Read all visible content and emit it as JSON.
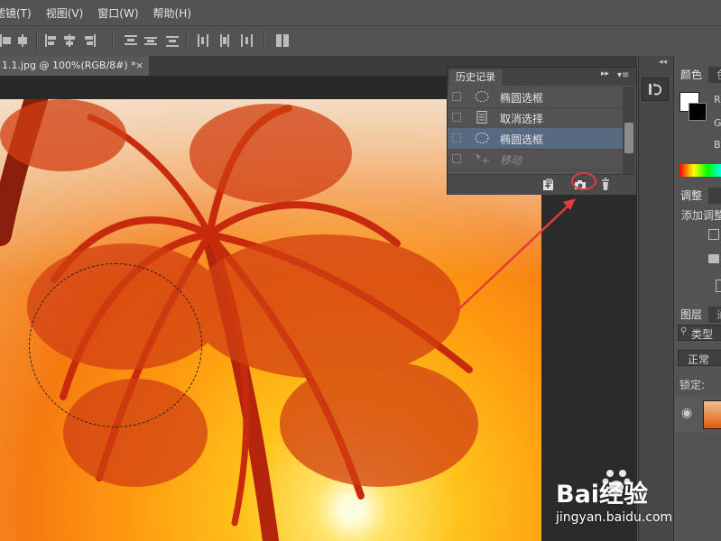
{
  "menu": {
    "items": [
      "滤镜(T)",
      "视图(V)",
      "窗口(W)",
      "帮助(H)"
    ]
  },
  "document": {
    "tab_title": "1.1.jpg @ 100%(RGB/8#) *",
    "close_glyph": "×"
  },
  "history_panel": {
    "title": "历史记录",
    "expand_glyph": "▸▸",
    "menu_glyph": "▾≡",
    "items": [
      {
        "label": "椭圆选框",
        "icon": "ellipse-marquee-icon",
        "selected": false,
        "dimmed": false
      },
      {
        "label": "取消选择",
        "icon": "document-icon",
        "selected": false,
        "dimmed": false
      },
      {
        "label": "椭圆选框",
        "icon": "ellipse-marquee-icon",
        "selected": true,
        "dimmed": false
      },
      {
        "label": "移动",
        "icon": "move-tool-icon",
        "selected": false,
        "dimmed": true
      }
    ],
    "footer_buttons": [
      "new-document-from-state-icon",
      "camera-snapshot-icon",
      "trash-icon"
    ]
  },
  "right_panels": {
    "collapse_glyph": "◂◂",
    "color_tab": "颜色",
    "color_tab_partial": "色",
    "rgb_labels": [
      "R",
      "G",
      "B"
    ],
    "adjust_tab": "调整",
    "adjust_add": "添加调整",
    "layers_tab": "图层",
    "layers_tab2": "通",
    "filter_placeholder": "类型",
    "blend_mode": "正常",
    "lock_label": "锁定:"
  },
  "watermark": {
    "brand_text": "Bai经验",
    "url": "jingyan.baidu.com"
  },
  "colors": {
    "highlight_red": "#e53b3b",
    "selected_row": "#586a82",
    "panel_bg": "#535353"
  }
}
